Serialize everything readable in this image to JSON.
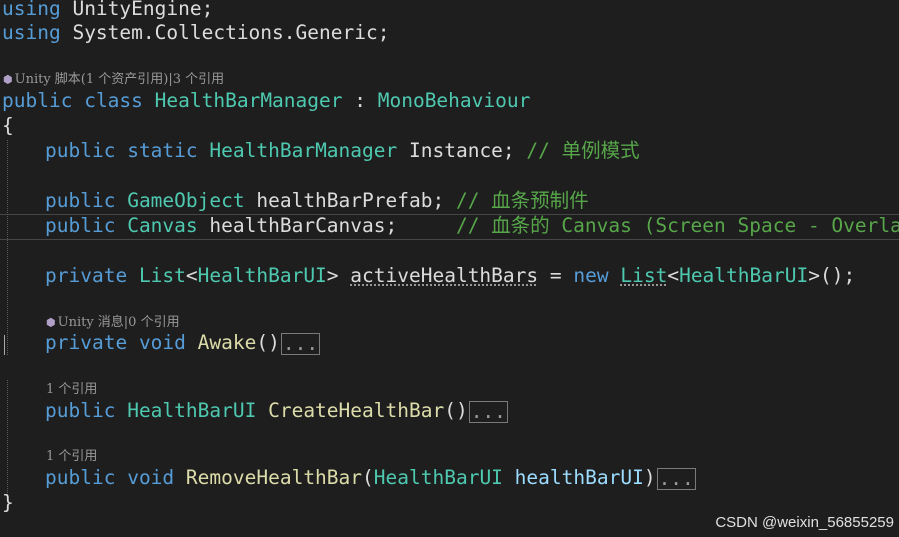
{
  "code": {
    "using1": {
      "kw": "using",
      "ns": "UnityEngine;"
    },
    "using2": {
      "kw": "using",
      "ns": "System.Collections.Generic;"
    },
    "class_lens": {
      "text": "Unity 脚本(1 个资产引用)|3 个引用"
    },
    "class_decl": {
      "kw1": "public",
      "kw2": "class",
      "name": "HealthBarManager",
      "sep": " : ",
      "base": "MonoBehaviour"
    },
    "open_brace": "{",
    "close_brace": "}",
    "instance_line": {
      "kw1": "public",
      "kw2": "static",
      "type": "HealthBarManager",
      "name": "Instance;",
      "comment": "// 单例模式"
    },
    "prefab_line": {
      "kw1": "public",
      "type": "GameObject",
      "name": "healthBarPrefab;",
      "comment": "// 血条预制件"
    },
    "canvas_line": {
      "kw1": "public",
      "type": "Canvas",
      "name": "healthBarCanvas;",
      "comment": "// 血条的 Canvas (Screen Space - Overlay)"
    },
    "list_line": {
      "kw1": "private",
      "type1": "List",
      "lt": "<",
      "arg1": "HealthBarUI",
      "gt": ">",
      "name": "activeHealthBars",
      "eq": " = ",
      "kw_new": "new",
      "type2": "List",
      "lt2": "<",
      "arg2": "HealthBarUI",
      "end": ">();"
    },
    "awake_lens": {
      "text": "Unity 消息|0 个引用"
    },
    "awake_line": {
      "kw1": "private",
      "kw2": "void",
      "name": "Awake",
      "parens": "()",
      "collapsed": "..."
    },
    "create_lens": {
      "text": "1 个引用"
    },
    "create_line": {
      "kw1": "public",
      "type": "HealthBarUI",
      "name": "CreateHealthBar",
      "parens": "()",
      "collapsed": "..."
    },
    "remove_lens": {
      "text": "1 个引用"
    },
    "remove_line": {
      "kw1": "public",
      "kw2": "void",
      "name": "RemoveHealthBar",
      "open": "(",
      "ptype": "HealthBarUI",
      "pname": "healthBarUI",
      "close": ")",
      "collapsed": "..."
    }
  },
  "watermark": "CSDN @weixin_56855259",
  "colors": {
    "background": "#1e1e1e",
    "keyword": "#569cd6",
    "type": "#4ec9b0",
    "method": "#dcdcaa",
    "identifier": "#dcdcdc",
    "parameter": "#9cdcfe",
    "comment": "#57a64a",
    "codelens": "#999999"
  },
  "icons": {
    "codelens_unity": "unity-cube-icon"
  }
}
